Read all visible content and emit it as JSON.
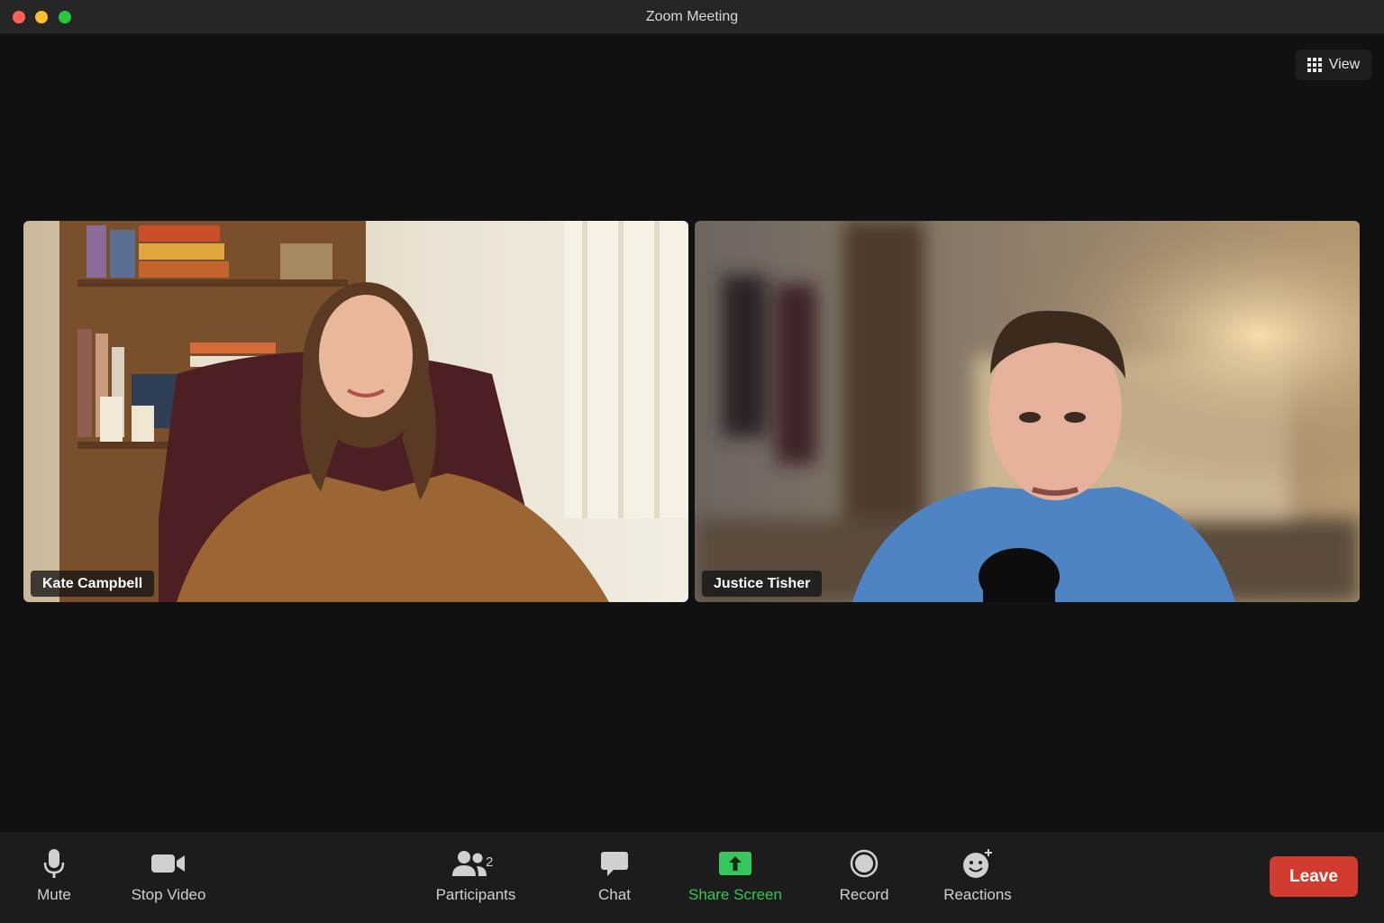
{
  "window": {
    "title": "Zoom Meeting"
  },
  "view_button": {
    "label": "View",
    "icon": "grid-icon"
  },
  "participants_tiles": [
    {
      "name": "Kate Campbell"
    },
    {
      "name": "Justice Tisher"
    }
  ],
  "toolbar": {
    "mute_label": "Mute",
    "stop_video_label": "Stop Video",
    "participants_label": "Participants",
    "participants_count": "2",
    "chat_label": "Chat",
    "share_screen_label": "Share Screen",
    "record_label": "Record",
    "reactions_label": "Reactions",
    "leave_label": "Leave"
  },
  "colors": {
    "share_accent": "#35c759",
    "leave_button": "#d13b30",
    "close": "#ff5f57",
    "minimize": "#febc2e",
    "maximize": "#28c840"
  }
}
